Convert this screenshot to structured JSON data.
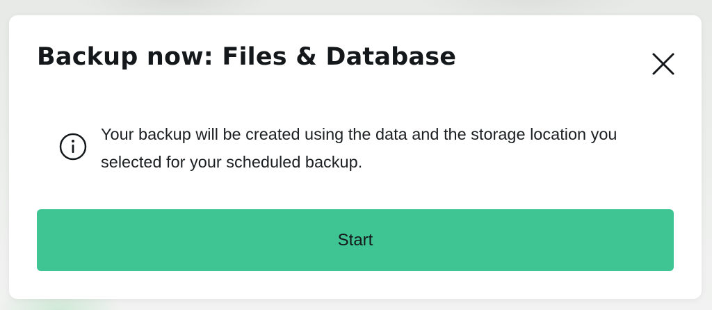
{
  "dialog": {
    "title": "Backup now: Files & Database",
    "close_icon": "close-icon",
    "info_icon": "info-icon",
    "message": "Your backup will be created using the data and the storage location you selected for your scheduled backup.",
    "start_label": "Start"
  },
  "colors": {
    "accent": "#3ec593",
    "text": "#14181a",
    "background": "#ffffff"
  }
}
